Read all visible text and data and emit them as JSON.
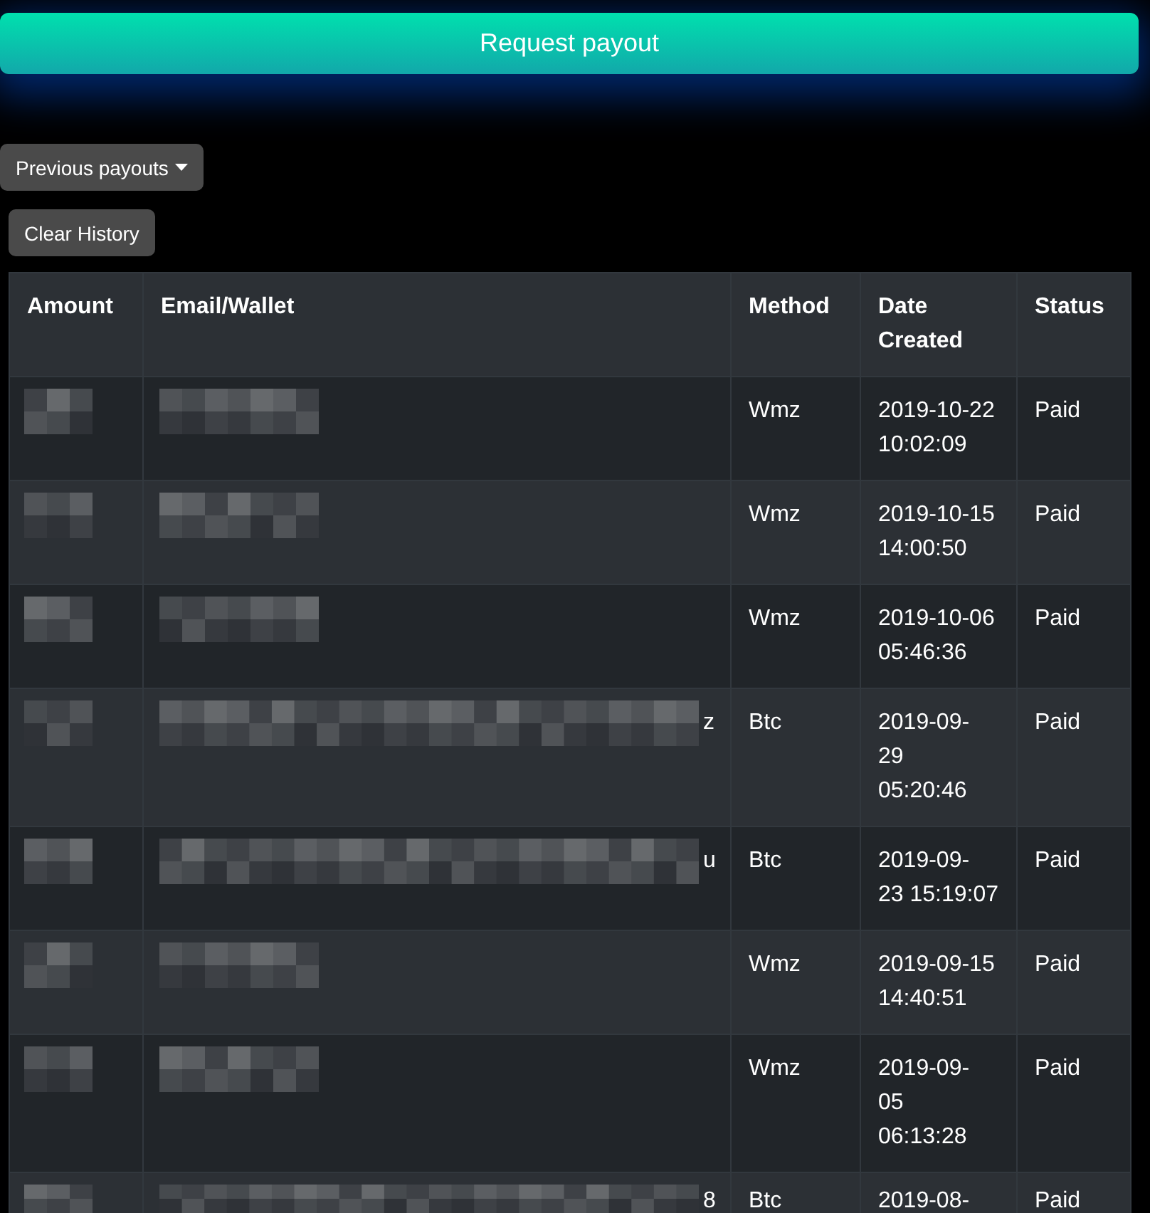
{
  "request_button": {
    "label": "Request payout"
  },
  "previous_payouts_button": {
    "label": "Previous payouts"
  },
  "clear_button": {
    "label": "Clear History"
  },
  "table": {
    "columns": [
      "Amount",
      "Email/Wallet",
      "Method",
      "Date Created",
      "Status"
    ],
    "rows": [
      {
        "kind": "short",
        "amount_redacted": true,
        "wallet_redacted": true,
        "method": "Wmz",
        "date_created": "2019-10-22\n10:02:09",
        "status": "Paid"
      },
      {
        "kind": "short",
        "amount_redacted": true,
        "wallet_redacted": true,
        "method": "Wmz",
        "date_created": "2019-10-15\n14:00:50",
        "status": "Paid"
      },
      {
        "kind": "short",
        "amount_redacted": true,
        "wallet_redacted": true,
        "method": "Wmz",
        "date_created": "2019-10-06\n05:46:36",
        "status": "Paid"
      },
      {
        "kind": "long",
        "amount_redacted": true,
        "wallet_redacted": true,
        "wallet_tail": "z",
        "method": "Btc",
        "date_created": "2019-09-\n29\n05:20:46",
        "status": "Paid"
      },
      {
        "kind": "long",
        "amount_redacted": true,
        "wallet_redacted": true,
        "wallet_tail": "u",
        "method": "Btc",
        "date_created": "2019-09-\n23 15:19:07",
        "status": "Paid"
      },
      {
        "kind": "short",
        "amount_redacted": true,
        "wallet_redacted": true,
        "method": "Wmz",
        "date_created": "2019-09-15\n14:40:51",
        "status": "Paid"
      },
      {
        "kind": "short",
        "amount_redacted": true,
        "wallet_redacted": true,
        "method": "Wmz",
        "date_created": "2019-09-\n05\n06:13:28",
        "status": "Paid"
      },
      {
        "kind": "long",
        "amount_redacted": true,
        "wallet_redacted": true,
        "wallet_tail": "8",
        "method": "Btc",
        "date_created": "2019-08-",
        "status": "Paid"
      }
    ]
  }
}
